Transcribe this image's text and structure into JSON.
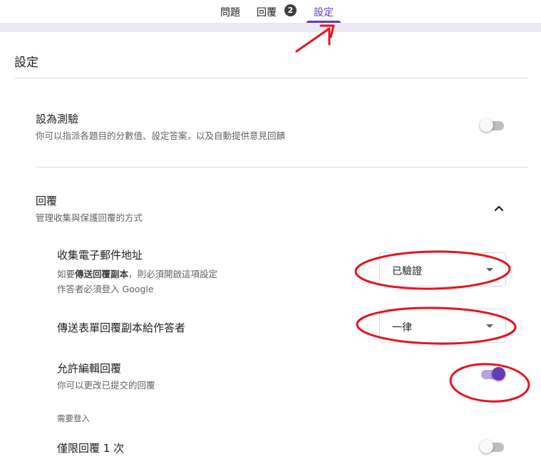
{
  "tabs": {
    "questions": "問題",
    "responses": "回覆",
    "responses_count": "2",
    "settings": "設定"
  },
  "page": {
    "title": "設定"
  },
  "quiz": {
    "title": "設為測驗",
    "description": "你可以指派各題目的分數值、設定答案，以及自動提供意見回饋",
    "enabled": false
  },
  "responses_section": {
    "title": "回覆",
    "description": "管理收集與保護回覆的方式",
    "expanded": true,
    "collect_email": {
      "title": "收集電子郵件地址",
      "desc_prefix": "如要",
      "desc_bold": "傳送回覆副本",
      "desc_suffix": "，則必須開啟這項設定",
      "desc_line2": "作答者必須登入 Google",
      "value": "已驗證"
    },
    "send_copy": {
      "title": "傳送表單回覆副本給作答者",
      "value": "一律"
    },
    "allow_edit": {
      "title": "允許編輯回覆",
      "description": "你可以更改已提交的回覆",
      "enabled": true
    },
    "requires_login_label": "需要登入",
    "limit_one": {
      "title": "僅限回覆 1 次",
      "enabled": false
    }
  },
  "colors": {
    "accent": "#673ab7",
    "annotation": "#e8141c"
  }
}
